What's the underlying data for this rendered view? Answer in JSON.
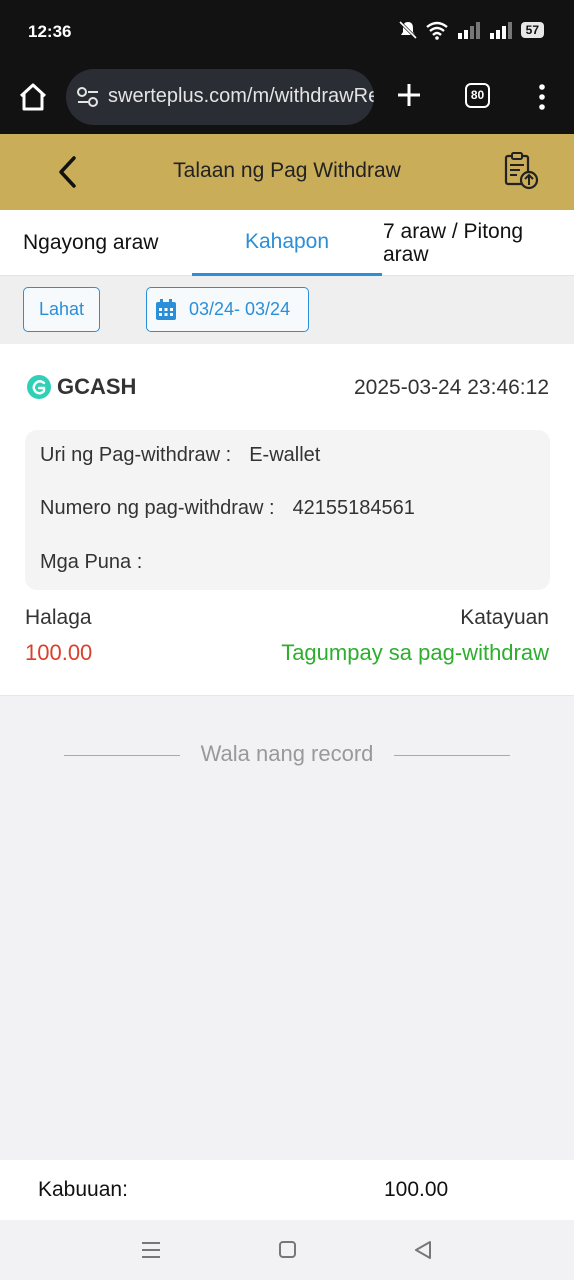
{
  "status_bar": {
    "time": "12:36",
    "battery": "57"
  },
  "browser": {
    "url": "swerteplus.com/m/withdrawRe",
    "tab_count": "80"
  },
  "header": {
    "title": "Talaan ng Pag Withdraw"
  },
  "tabs": [
    {
      "label": "Ngayong araw",
      "active": false
    },
    {
      "label": "Kahapon",
      "active": true
    },
    {
      "label": "7 araw / Pitong araw",
      "active": false
    }
  ],
  "filter": {
    "all_label": "Lahat",
    "date_range": "03/24- 03/24"
  },
  "record": {
    "method": "GCASH",
    "datetime": "2025-03-24 23:46:12",
    "details": [
      {
        "label": "Uri ng Pag-withdraw :",
        "value": "E-wallet"
      },
      {
        "label": "Numero ng pag-withdraw :",
        "value": "42155184561"
      },
      {
        "label": "Mga Puna :",
        "value": ""
      }
    ],
    "amount_label": "Halaga",
    "amount": "100.00",
    "status_label": "Katayuan",
    "status": "Tagumpay sa pag-withdraw"
  },
  "empty_notice": "Wala nang record",
  "total": {
    "label": "Kabuuan:",
    "value": "100.00"
  },
  "colors": {
    "header_bg": "#c9ad58",
    "accent": "#2a8fd8",
    "amount": "#d9412c",
    "success": "#2dae2d",
    "gcash": "#2fd0b5"
  }
}
